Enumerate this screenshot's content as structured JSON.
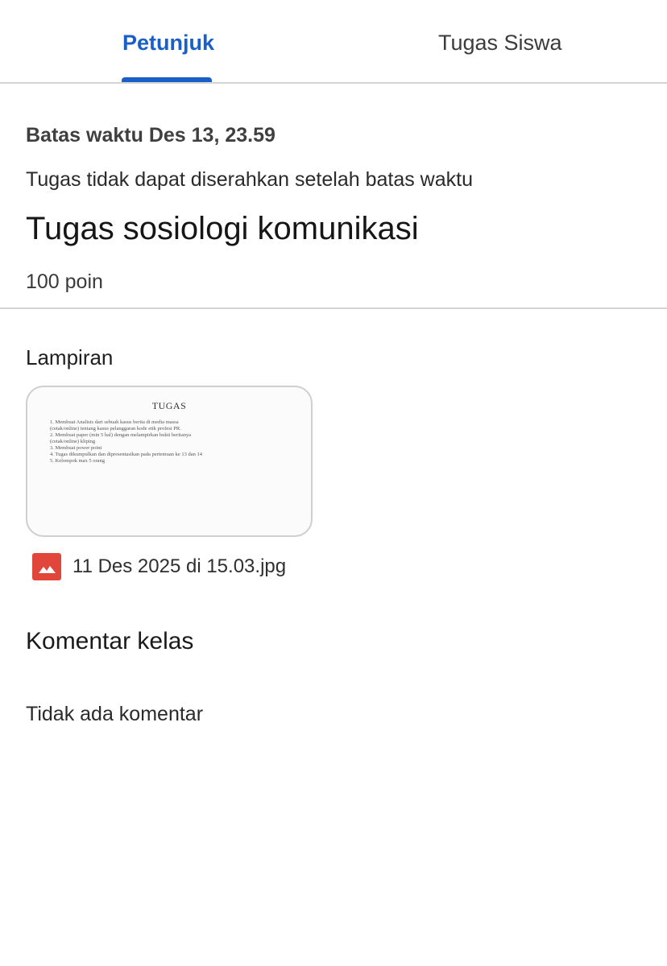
{
  "tabs": {
    "active": "Petunjuk",
    "other": "Tugas Siswa"
  },
  "assignment": {
    "due": "Batas waktu Des 13, 23.59",
    "late_note": "Tugas tidak dapat diserahkan setelah batas waktu",
    "title": "Tugas sosiologi komunikasi",
    "points": "100 poin"
  },
  "attachments": {
    "label": "Lampiran",
    "preview": {
      "heading": "TUGAS",
      "lines": [
        "1.   Membuat Analisis dari sebuah kasus berita di media massa",
        "      (cetak/online) tentang kasus pelanggaran kode etik profesi PR.",
        "2.   Membuat paper (min 5 hal) dengan melampirkan bukti beritanya",
        "      (cetak/online) kliping",
        "3.   Membuat power point",
        "4.   Tugas dikumpulkan dan dipresentasikan pada pertemuan ke 13 dan 14",
        "5.   Kelompok max 5 orang"
      ]
    },
    "file_name": "11 Des 2025 di 15.03.jpg",
    "file_icon": "image-file-icon",
    "file_icon_color": "#e0463a"
  },
  "comments": {
    "label": "Komentar kelas",
    "empty": "Tidak ada komentar"
  },
  "colors": {
    "accent": "#1a5fc8"
  }
}
